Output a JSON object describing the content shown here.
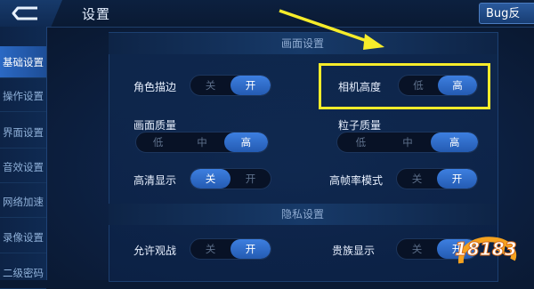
{
  "header": {
    "title": "设置",
    "bug_label": "Bug反"
  },
  "sidebar": {
    "items": [
      {
        "label": "基础设置",
        "active": true
      },
      {
        "label": "操作设置",
        "active": false
      },
      {
        "label": "界面设置",
        "active": false
      },
      {
        "label": "音效设置",
        "active": false
      },
      {
        "label": "网络加速",
        "active": false
      },
      {
        "label": "录像设置",
        "active": false
      },
      {
        "label": "二级密码",
        "active": false
      }
    ]
  },
  "sections": {
    "display": "画面设置",
    "privacy": "隐私设置"
  },
  "settings": {
    "role_outline": {
      "label": "角色描边",
      "options": [
        "关",
        "开"
      ],
      "selected": "开"
    },
    "camera_height": {
      "label": "相机高度",
      "options": [
        "低",
        "高"
      ],
      "selected": "高"
    },
    "image_quality": {
      "label": "画面质量",
      "options": [
        "低",
        "中",
        "高"
      ],
      "selected": "高"
    },
    "particle_quality": {
      "label": "粒子质量",
      "options": [
        "低",
        "中",
        "高"
      ],
      "selected": "高"
    },
    "hd_display": {
      "label": "高清显示",
      "options": [
        "关",
        "开"
      ],
      "selected": "关"
    },
    "high_fps": {
      "label": "高帧率模式",
      "options": [
        "关",
        "开"
      ],
      "selected": "开"
    },
    "allow_spectate": {
      "label": "允许观战",
      "options": [
        "关",
        "开"
      ],
      "selected": "开"
    },
    "noble_display": {
      "label": "贵族显示",
      "options": [
        "关",
        "开"
      ],
      "selected": "开"
    }
  },
  "watermark": {
    "text": "18183"
  },
  "colors": {
    "highlight": "#f6ec2a",
    "toggle_on": "#2f6fd0",
    "sidebar_active": "#2b69c4"
  },
  "icons": {
    "back": "back-arrow-icon",
    "annotation": "yellow-arrow-icon"
  }
}
